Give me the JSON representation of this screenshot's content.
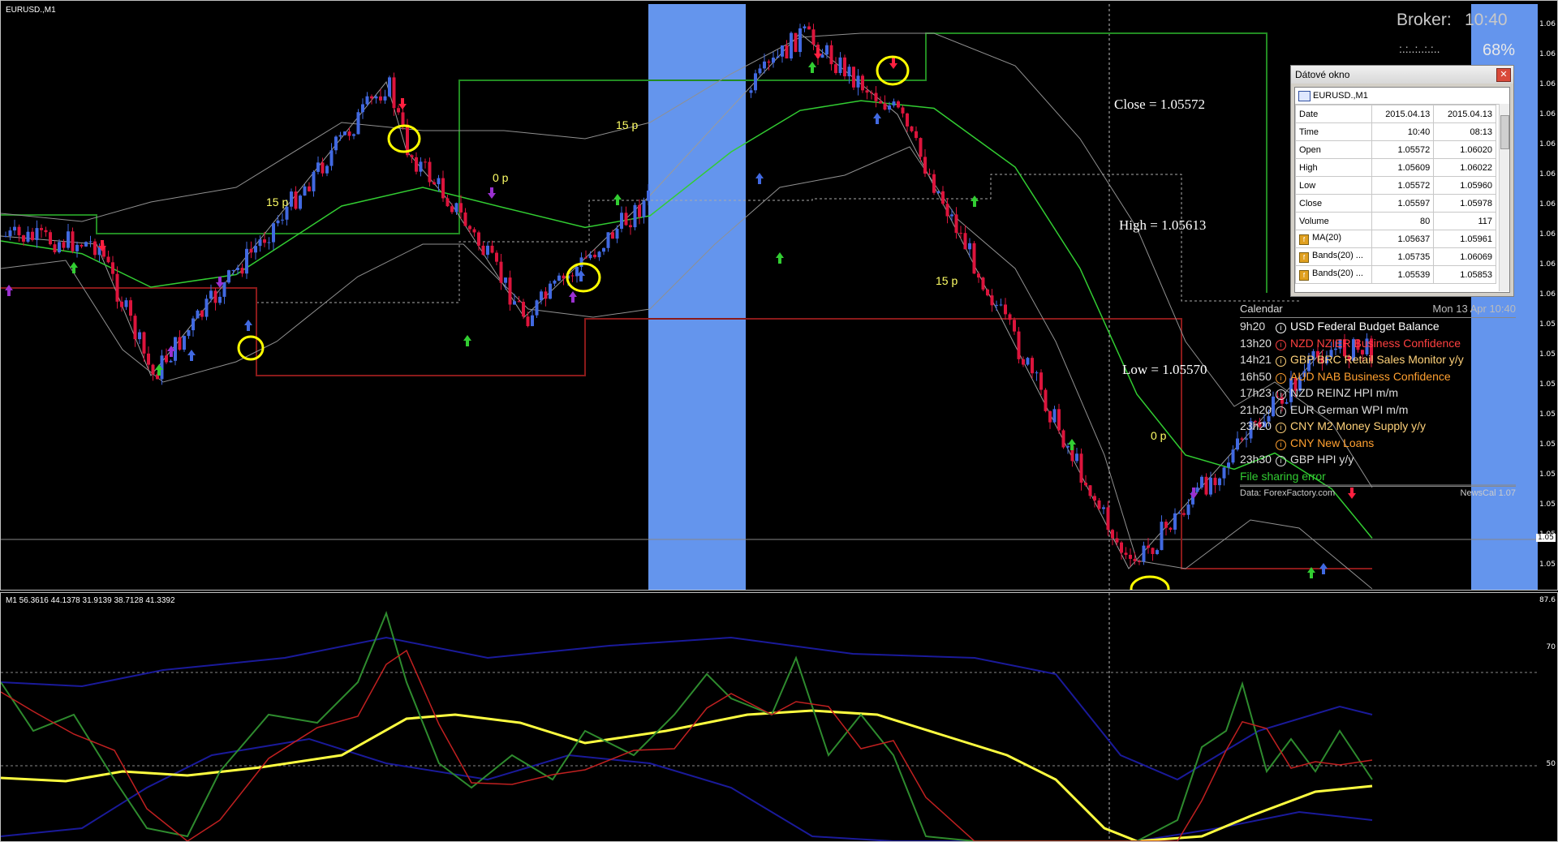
{
  "main_chart": {
    "title": "EURUSD.,M1",
    "price_axis": [
      "1.06",
      "1.06",
      "1.06",
      "1.06",
      "1.06",
      "1.06",
      "1.06",
      "1.06",
      "1.06",
      "1.06",
      "1.05",
      "1.05",
      "1.05",
      "1.05",
      "1.05",
      "1.05",
      "1.05",
      "1.05",
      "1.05",
      "1.05"
    ],
    "current_price_label": "1.05",
    "annotations": {
      "close": "Close = 1.05572",
      "high": "High = 1.05613",
      "low": "Low = 1.05570"
    },
    "pip_labels": [
      "15 p",
      "0 p",
      "15 p",
      "15 p",
      "0 p"
    ],
    "broker_label": "Broker:",
    "broker_time": "10:40",
    "progress_text": ":.:..:..:.:..",
    "progress_percent": "68%"
  },
  "data_window": {
    "title": "Dátové okno",
    "symbol": "EURUSD.,M1",
    "rows": [
      {
        "label": "Date",
        "v1": "2015.04.13",
        "v2": "2015.04.13",
        "icon": false
      },
      {
        "label": "Time",
        "v1": "10:40",
        "v2": "08:13",
        "icon": false
      },
      {
        "label": "Open",
        "v1": "1.05572",
        "v2": "1.06020",
        "icon": false
      },
      {
        "label": "High",
        "v1": "1.05609",
        "v2": "1.06022",
        "icon": false
      },
      {
        "label": "Low",
        "v1": "1.05572",
        "v2": "1.05960",
        "icon": false
      },
      {
        "label": "Close",
        "v1": "1.05597",
        "v2": "1.05978",
        "icon": false
      },
      {
        "label": "Volume",
        "v1": "80",
        "v2": "117",
        "icon": false
      },
      {
        "label": "MA(20)",
        "v1": "1.05637",
        "v2": "1.05961",
        "icon": true
      },
      {
        "label": "Bands(20) ...",
        "v1": "1.05735",
        "v2": "1.06069",
        "icon": true
      },
      {
        "label": "Bands(20) ...",
        "v1": "1.05539",
        "v2": "1.05853",
        "icon": true
      }
    ]
  },
  "calendar": {
    "title": "Calendar",
    "date": "Mon 13 Apr 10:40",
    "events": [
      {
        "time": "9h20",
        "text": "USD Federal Budget Balance",
        "color": "#ffffff"
      },
      {
        "time": "13h20",
        "text": "NZD NZIER Business Confidence",
        "color": "#ff4040"
      },
      {
        "time": "14h21",
        "text": "GBP BRC Retail Sales Monitor y/y",
        "color": "#ffd27a"
      },
      {
        "time": "16h50",
        "text": "AUD NAB Business Confidence",
        "color": "#ffa030"
      },
      {
        "time": "17h23",
        "text": "NZD REINZ HPI m/m",
        "color": "#dddddd"
      },
      {
        "time": "21h20",
        "text": "EUR German WPI m/m",
        "color": "#dddddd"
      },
      {
        "time": "23h20",
        "text": "CNY M2 Money Supply y/y",
        "color": "#ffd27a"
      },
      {
        "time": "",
        "text": "CNY New Loans",
        "color": "#ffa030"
      },
      {
        "time": "23h30",
        "text": "GBP HPI y/y",
        "color": "#dddddd"
      }
    ],
    "error_text": "File sharing error",
    "source": "Data: ForexFactory.com",
    "version": "NewsCal 1.07"
  },
  "oscillator": {
    "title": "M1  56.3616 44.1378 31.9139 38.7128 41.3392",
    "axis": [
      "87.6",
      "70",
      "50"
    ]
  },
  "colors": {
    "bull": "#4169e1",
    "bear": "#dc143c",
    "band": "#909090",
    "ma": "#32cd32",
    "session": "#6495ed",
    "highlight": "#ffff00"
  }
}
